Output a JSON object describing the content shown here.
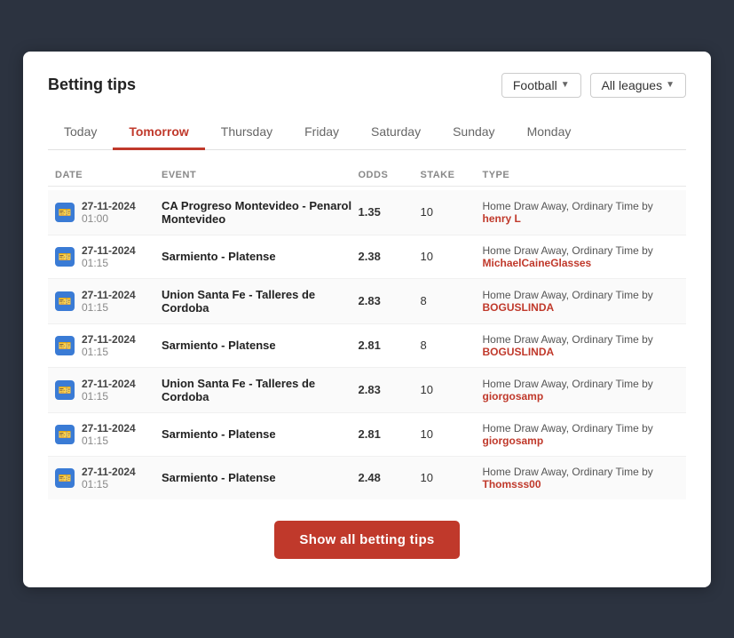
{
  "header": {
    "title": "Betting tips",
    "filter_football_label": "Football",
    "filter_leagues_label": "All leagues"
  },
  "tabs": [
    {
      "label": "Today",
      "active": false
    },
    {
      "label": "Tomorrow",
      "active": true
    },
    {
      "label": "Thursday",
      "active": false
    },
    {
      "label": "Friday",
      "active": false
    },
    {
      "label": "Saturday",
      "active": false
    },
    {
      "label": "Sunday",
      "active": false
    },
    {
      "label": "Monday",
      "active": false
    }
  ],
  "table": {
    "columns": [
      "DATE",
      "EVENT",
      "ODDS",
      "STAKE",
      "TYPE"
    ],
    "rows": [
      {
        "date": "27-11-2024",
        "time": "01:00",
        "event": "CA Progreso Montevideo - Penarol Montevideo",
        "odds": "1.35",
        "stake": "10",
        "type_text": "Home Draw Away, Ordinary Time by ",
        "user": "henry L",
        "user_color": "red"
      },
      {
        "date": "27-11-2024",
        "time": "01:15",
        "event": "Sarmiento - Platense",
        "odds": "2.38",
        "stake": "10",
        "type_text": "Home Draw Away, Ordinary Time by ",
        "user": "MichaelCaineGlasses",
        "user_color": "red"
      },
      {
        "date": "27-11-2024",
        "time": "01:15",
        "event": "Union Santa Fe - Talleres de Cordoba",
        "odds": "2.83",
        "stake": "8",
        "type_text": "Home Draw Away, Ordinary Time by ",
        "user": "BOGUSLINDA",
        "user_color": "red"
      },
      {
        "date": "27-11-2024",
        "time": "01:15",
        "event": "Sarmiento - Platense",
        "odds": "2.81",
        "stake": "8",
        "type_text": "Home Draw Away, Ordinary Time by ",
        "user": "BOGUSLINDA",
        "user_color": "red"
      },
      {
        "date": "27-11-2024",
        "time": "01:15",
        "event": "Union Santa Fe - Talleres de Cordoba",
        "odds": "2.83",
        "stake": "10",
        "type_text": "Home Draw Away, Ordinary Time by ",
        "user": "giorgosamp",
        "user_color": "red"
      },
      {
        "date": "27-11-2024",
        "time": "01:15",
        "event": "Sarmiento - Platense",
        "odds": "2.81",
        "stake": "10",
        "type_text": "Home Draw Away, Ordinary Time by ",
        "user": "giorgosamp",
        "user_color": "red"
      },
      {
        "date": "27-11-2024",
        "time": "01:15",
        "event": "Sarmiento - Platense",
        "odds": "2.48",
        "stake": "10",
        "type_text": "Home Draw Away, Ordinary Time by ",
        "user": "Thomsss00",
        "user_color": "red"
      }
    ]
  },
  "show_button_label": "Show all betting tips"
}
